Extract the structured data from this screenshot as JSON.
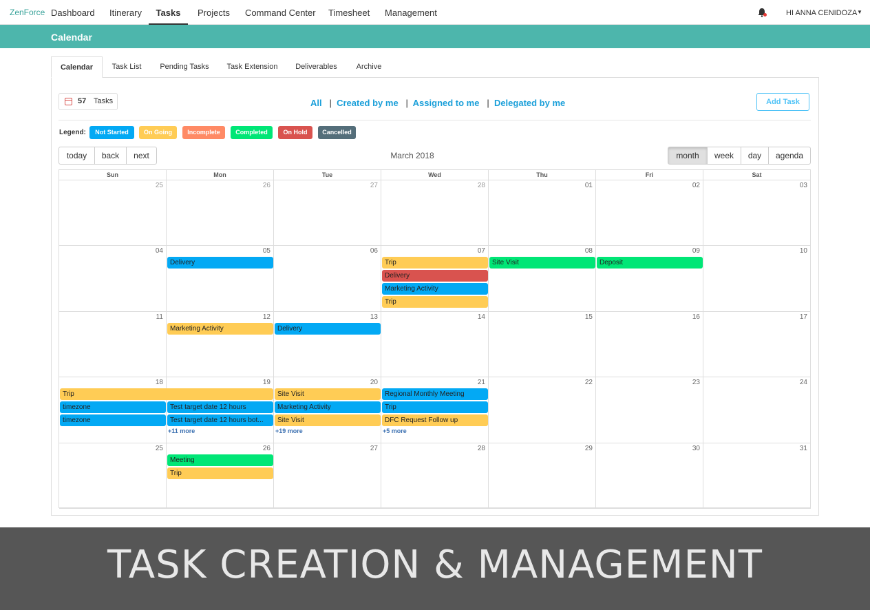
{
  "nav": {
    "brand": "ZenForce",
    "items": [
      "Dashboard",
      "Itinerary",
      "Tasks",
      "Projects",
      "Command Center",
      "Timesheet",
      "Management"
    ],
    "active": "Tasks",
    "user": "HI ANNA CENIDOZA"
  },
  "page": {
    "title": "Calendar"
  },
  "tabs": [
    "Calendar",
    "Task List",
    "Pending Tasks",
    "Task Extension",
    "Deliverables",
    "Archive"
  ],
  "task_count": {
    "number": "57",
    "label": "Tasks"
  },
  "filters": [
    "All",
    "Created by me",
    "Assigned to me",
    "Delegated by me"
  ],
  "add_task": "Add Task",
  "legend": {
    "label": "Legend:",
    "items": [
      {
        "label": "Not Started",
        "color": "#03a9f4"
      },
      {
        "label": "On Going",
        "color": "#ffcc55"
      },
      {
        "label": "Incomplete",
        "color": "#ff8a65"
      },
      {
        "label": "Completed",
        "color": "#00e676"
      },
      {
        "label": "On Hold",
        "color": "#d9534f"
      },
      {
        "label": "Cancelled",
        "color": "#546e7a"
      }
    ]
  },
  "toolbar": {
    "today": "today",
    "back": "back",
    "next": "next",
    "title": "March 2018",
    "views": [
      "month",
      "week",
      "day",
      "agenda"
    ],
    "active_view": "month"
  },
  "calendar": {
    "weekdays": [
      "Sun",
      "Mon",
      "Tue",
      "Wed",
      "Thu",
      "Fri",
      "Sat"
    ],
    "weeks": [
      [
        "25",
        "26",
        "27",
        "28",
        "01",
        "02",
        "03"
      ],
      [
        "04",
        "05",
        "06",
        "07",
        "08",
        "09",
        "10"
      ],
      [
        "11",
        "12",
        "13",
        "14",
        "15",
        "16",
        "17"
      ],
      [
        "18",
        "19",
        "20",
        "21",
        "22",
        "23",
        "24"
      ],
      [
        "25",
        "26",
        "27",
        "28",
        "29",
        "30",
        "31"
      ]
    ],
    "events": [
      {
        "week": 1,
        "day": 1,
        "span": 1,
        "slot": 0,
        "title": "Delivery",
        "status": "blue"
      },
      {
        "week": 1,
        "day": 3,
        "span": 1,
        "slot": 0,
        "title": "Trip",
        "status": "yellow"
      },
      {
        "week": 1,
        "day": 3,
        "span": 1,
        "slot": 1,
        "title": "Delivery",
        "status": "red"
      },
      {
        "week": 1,
        "day": 3,
        "span": 1,
        "slot": 2,
        "title": "Marketing Activity",
        "status": "blue"
      },
      {
        "week": 1,
        "day": 3,
        "span": 1,
        "slot": 3,
        "title": "Trip",
        "status": "yellow"
      },
      {
        "week": 1,
        "day": 4,
        "span": 1,
        "slot": 0,
        "title": "Site Visit",
        "status": "green"
      },
      {
        "week": 1,
        "day": 5,
        "span": 1,
        "slot": 0,
        "title": "Deposit",
        "status": "green"
      },
      {
        "week": 2,
        "day": 1,
        "span": 1,
        "slot": 0,
        "title": "Marketing Activity",
        "status": "yellow"
      },
      {
        "week": 2,
        "day": 2,
        "span": 1,
        "slot": 0,
        "title": "Delivery",
        "status": "blue"
      },
      {
        "week": 3,
        "day": 0,
        "span": 2,
        "slot": 0,
        "title": "Trip",
        "status": "yellow"
      },
      {
        "week": 3,
        "day": 0,
        "span": 1,
        "slot": 1,
        "title": "timezone",
        "status": "blue"
      },
      {
        "week": 3,
        "day": 0,
        "span": 1,
        "slot": 2,
        "title": "timezone",
        "status": "blue"
      },
      {
        "week": 3,
        "day": 1,
        "span": 1,
        "slot": 1,
        "title": "Test target date 12 hours",
        "status": "blue"
      },
      {
        "week": 3,
        "day": 1,
        "span": 1,
        "slot": 2,
        "title": "Test target date 12 hours bot...",
        "status": "blue"
      },
      {
        "week": 3,
        "day": 2,
        "span": 1,
        "slot": 0,
        "title": "Site Visit",
        "status": "yellow"
      },
      {
        "week": 3,
        "day": 2,
        "span": 1,
        "slot": 1,
        "title": "Marketing Activity",
        "status": "blue"
      },
      {
        "week": 3,
        "day": 2,
        "span": 1,
        "slot": 2,
        "title": "Site Visit",
        "status": "yellow"
      },
      {
        "week": 3,
        "day": 3,
        "span": 1,
        "slot": 0,
        "title": "Regional Monthly Meeting",
        "status": "blue"
      },
      {
        "week": 3,
        "day": 3,
        "span": 1,
        "slot": 1,
        "title": "Trip",
        "status": "blue"
      },
      {
        "week": 3,
        "day": 3,
        "span": 1,
        "slot": 2,
        "title": "DFC Request Follow up",
        "status": "yellow"
      },
      {
        "week": 4,
        "day": 1,
        "span": 1,
        "slot": 0,
        "title": "Meeting",
        "status": "green"
      },
      {
        "week": 4,
        "day": 1,
        "span": 1,
        "slot": 1,
        "title": "Trip",
        "status": "yellow"
      }
    ],
    "more_links": [
      {
        "week": 3,
        "day": 1,
        "text": "+11 more"
      },
      {
        "week": 3,
        "day": 2,
        "text": "+19 more"
      },
      {
        "week": 3,
        "day": 3,
        "text": "+5 more"
      }
    ],
    "status_colors": {
      "blue": "#03a9f4",
      "yellow": "#ffcc55",
      "red": "#d9534f",
      "green": "#00e676"
    }
  },
  "banner": {
    "text": "TASK CREATION & MANAGEMENT"
  }
}
